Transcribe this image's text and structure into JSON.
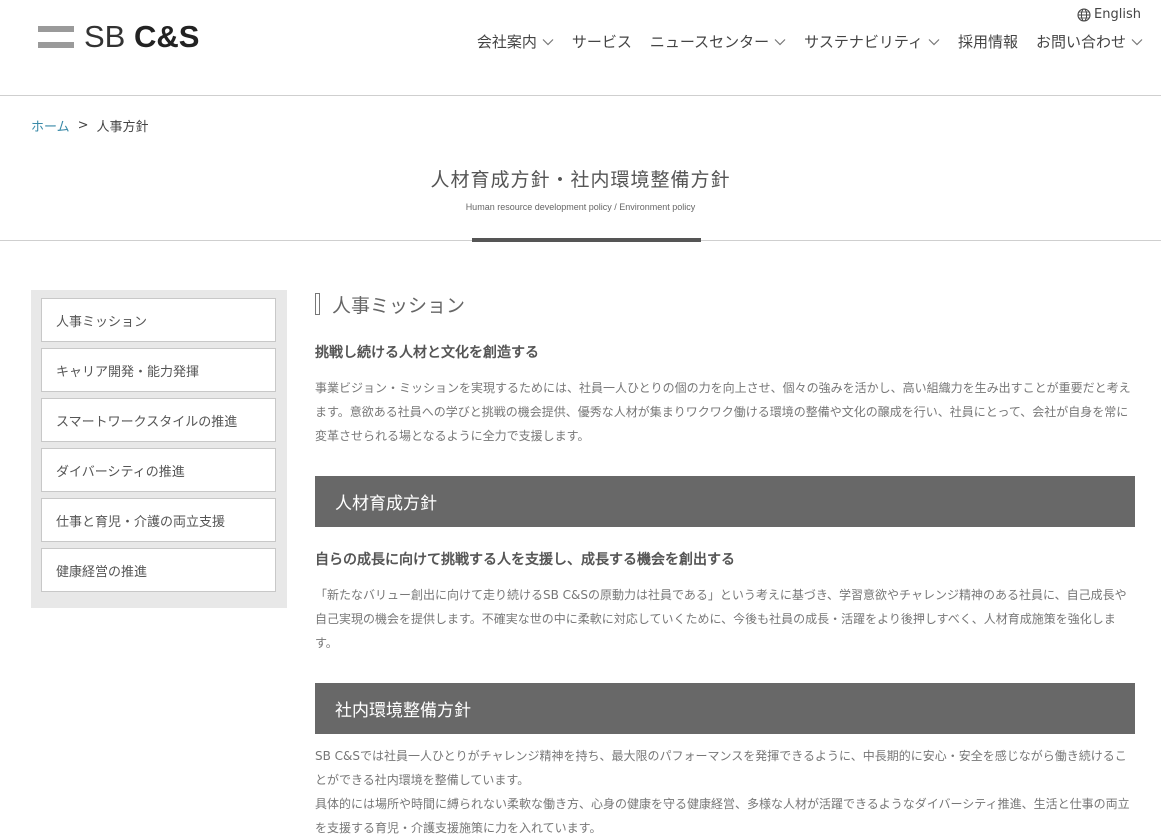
{
  "header": {
    "logo": {
      "prefix": "SB",
      "brand": "C&S"
    },
    "language": "English",
    "nav": [
      {
        "label": "会社案内",
        "dropdown": true
      },
      {
        "label": "サービス",
        "dropdown": false
      },
      {
        "label": "ニュースセンター",
        "dropdown": true
      },
      {
        "label": "サステナビリティ",
        "dropdown": true
      },
      {
        "label": "採用情報",
        "dropdown": false
      },
      {
        "label": "お問い合わせ",
        "dropdown": true
      }
    ]
  },
  "breadcrumb": {
    "home": "ホーム",
    "separator": ">",
    "current": "人事方針"
  },
  "page": {
    "title": "人材育成方針・社内環境整備方針",
    "subtitle": "Human resource development policy / Environment policy"
  },
  "sidebar": {
    "items": [
      {
        "label": "人事ミッション"
      },
      {
        "label": "キャリア開発・能力発揮"
      },
      {
        "label": "スマートワークスタイルの推進"
      },
      {
        "label": "ダイバーシティの推進"
      },
      {
        "label": "仕事と育児・介護の両立支援"
      },
      {
        "label": "健康経営の推進"
      }
    ]
  },
  "main": {
    "mission": {
      "heading": "人事ミッション",
      "lead": "挑戦し続ける人材と文化を創造する",
      "body": "事業ビジョン・ミッションを実現するためには、社員一人ひとりの個の力を向上させ、個々の強みを活かし、高い組織力を生み出すことが重要だと考えます。意欲ある社員への学びと挑戦の機会提供、優秀な人材が集まりワクワク働ける環境の整備や文化の醸成を行い、社員にとって、会社が自身を常に変革させられる場となるように全力で支援します。"
    },
    "development": {
      "banner": "人材育成方針",
      "lead": "自らの成長に向けて挑戦する人を支援し、成長する機会を創出する",
      "body": "「新たなバリュー創出に向けて走り続けるSB C&Sの原動力は社員である」という考えに基づき、学習意欲やチャレンジ精神のある社員に、自己成長や自己実現の機会を提供します。不確実な世の中に柔軟に対応していくために、今後も社員の成長・活躍をより後押しすべく、人材育成施策を強化します。"
    },
    "environment": {
      "banner": "社内環境整備方針",
      "body1": "SB C&Sでは社員一人ひとりがチャレンジ精神を持ち、最大限のパフォーマンスを発揮できるように、中長期的に安心・安全を感じながら働き続けることができる社内環境を整備しています。",
      "body2": "具体的には場所や時間に縛られない柔軟な働き方、心身の健康を守る健康経営、多様な人材が活躍できるようなダイバーシティ推進、生活と仕事の両立を支援する育児・介護支援施策に力を入れています。"
    }
  },
  "colors": {
    "banner": "#686868",
    "link": "#3a8aa8",
    "sidebar_bg": "#e8e8e8",
    "logo_mark": "#9a9a9a"
  }
}
